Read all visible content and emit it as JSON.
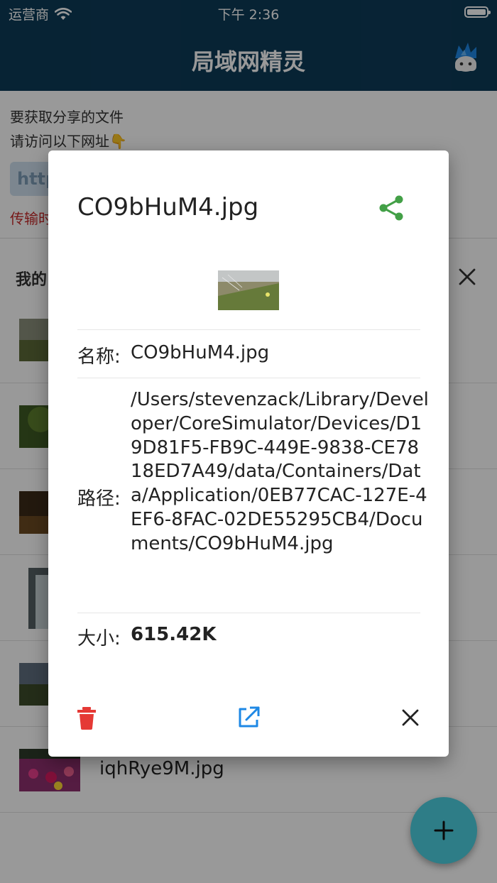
{
  "status_bar": {
    "carrier": "运营商",
    "time": "下午 2:36"
  },
  "app_bar": {
    "title": "局域网精灵"
  },
  "page": {
    "hint_line1": "要获取分享的文件",
    "hint_line2": "请访问以下网址👇",
    "url_partial": "http",
    "transfer_partial": "传输时",
    "list_title_partial": "我的",
    "files": [
      {
        "name": ""
      },
      {
        "name": ""
      },
      {
        "name": ""
      },
      {
        "name": ""
      },
      {
        "name": ""
      },
      {
        "name": "iqhRye9M.jpg"
      }
    ]
  },
  "dialog": {
    "title": "CO9bHuM4.jpg",
    "name_label": "名称:",
    "name_value": "CO9bHuM4.jpg",
    "path_label": "路径:",
    "path_value": "/Users/stevenzack/Library/Developer/CoreSimulator/Devices/D19D81F5-FB9C-449E-9838-CE7818ED7A49/data/Containers/Data/Application/0EB77CAC-127E-4EF6-8FAC-02DE55295CB4/Documents/CO9bHuM4.jpg",
    "size_label": "大小:",
    "size_value": "615.42K"
  },
  "icons": {
    "wifi": "wifi-icon",
    "battery": "battery-icon",
    "avatar": "mascot-avatar-icon",
    "share": "share-icon",
    "delete": "delete-icon",
    "open": "open-external-icon",
    "close": "close-icon",
    "add": "add-icon"
  },
  "colors": {
    "app_bar": "#0d3b58",
    "share": "#43a047",
    "delete": "#e53935",
    "open": "#1e88e5",
    "fab": "#4dd0e1",
    "transfer_text": "#c62828"
  }
}
